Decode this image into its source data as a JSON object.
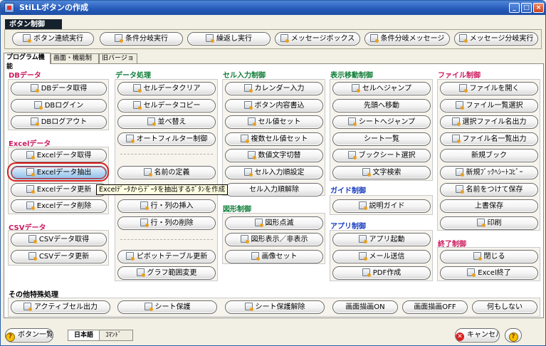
{
  "window": {
    "title": "StiLLボタンの作成"
  },
  "button_section": {
    "header": "ボタン制御",
    "buttons": [
      "ボタン連続実行",
      "条件分岐実行",
      "繰返し実行",
      "メッセージボックス",
      "条件分岐メッセージ",
      "メッセージ分岐実行"
    ]
  },
  "tabs": [
    "プログラム機能",
    "画面・機能制御",
    "旧バージョン"
  ],
  "groups": {
    "db": {
      "title": "DBデータ",
      "buttons": [
        "DBデータ取得",
        "DBログイン",
        "DBログアウト"
      ]
    },
    "excel": {
      "title": "Excelデータ",
      "buttons": [
        "Excelデータ取得",
        "Excelデータ抽出",
        "Excelデータ更新",
        "Excelデータ削除"
      ]
    },
    "csv": {
      "title": "CSVデータ",
      "buttons": [
        "CSVデータ取得",
        "CSVデータ更新"
      ]
    },
    "data": {
      "title": "データ処理",
      "buttons": [
        "セルデータクリア",
        "セルデータコピー",
        "並べ替え",
        "オートフィルター制御",
        "名前の定義",
        "行・列の挿入",
        "行・列の削除",
        "ピボットテーブル更新",
        "グラフ範囲変更"
      ]
    },
    "cellinput": {
      "title": "セル入力制御",
      "buttons": [
        "カレンダー入力",
        "ボタン内容書込",
        "セル値セット",
        "複数セル値セット",
        "数値文字切替",
        "セル入力順設定",
        "セル入力順解除"
      ]
    },
    "shape": {
      "title": "図形制御",
      "buttons": [
        "図形点滅",
        "図形表示／非表示",
        "画像セット"
      ]
    },
    "display": {
      "title": "表示移動制御",
      "buttons": [
        "セルへジャンプ",
        "先頭へ移動",
        "シートへジャンプ",
        "シート一覧",
        "ブックシート選択",
        "文字検索"
      ]
    },
    "guide": {
      "title": "ガイド制御",
      "buttons": [
        "説明ガイド"
      ]
    },
    "app": {
      "title": "アプリ制御",
      "buttons": [
        "アプリ起動",
        "メール送信",
        "PDF作成"
      ]
    },
    "file": {
      "title": "ファイル制御",
      "buttons": [
        "ファイルを開く",
        "ファイル一覧選択",
        "選択ファイル名出力",
        "ファイル名一覧出力",
        "新規ブック",
        "新規ﾌﾞｯｸﾍｼｰﾄｺﾋﾟｰ",
        "名前をつけて保存",
        "上書保存",
        "印刷"
      ]
    },
    "end": {
      "title": "終了制御",
      "buttons": [
        "閉じる",
        "Excel終了"
      ]
    },
    "other": {
      "title": "その他特殊処理",
      "buttons": [
        "アクティブセル出力",
        "シート保護",
        "シート保護解除",
        "画面描画ON",
        "画面描画OFF",
        "何もしない"
      ]
    }
  },
  "tooltip": "Excelﾃﾞｰﾀからﾃﾞｰﾀを抽出するﾎﾞﾀﾝを作成",
  "bottom": {
    "button_list": "ボタン一覧",
    "lang_ja": "日本語",
    "lang_cmd": "ｺﾏﾝﾄﾞ",
    "cancel": "キャンセル",
    "help": "?"
  },
  "colors": {
    "titlebar": "#2459b8",
    "group_red": "#cc1a5e",
    "group_green": "#0f7d37",
    "group_blue": "#1a3fc0",
    "selected_ring": "#d82020"
  }
}
